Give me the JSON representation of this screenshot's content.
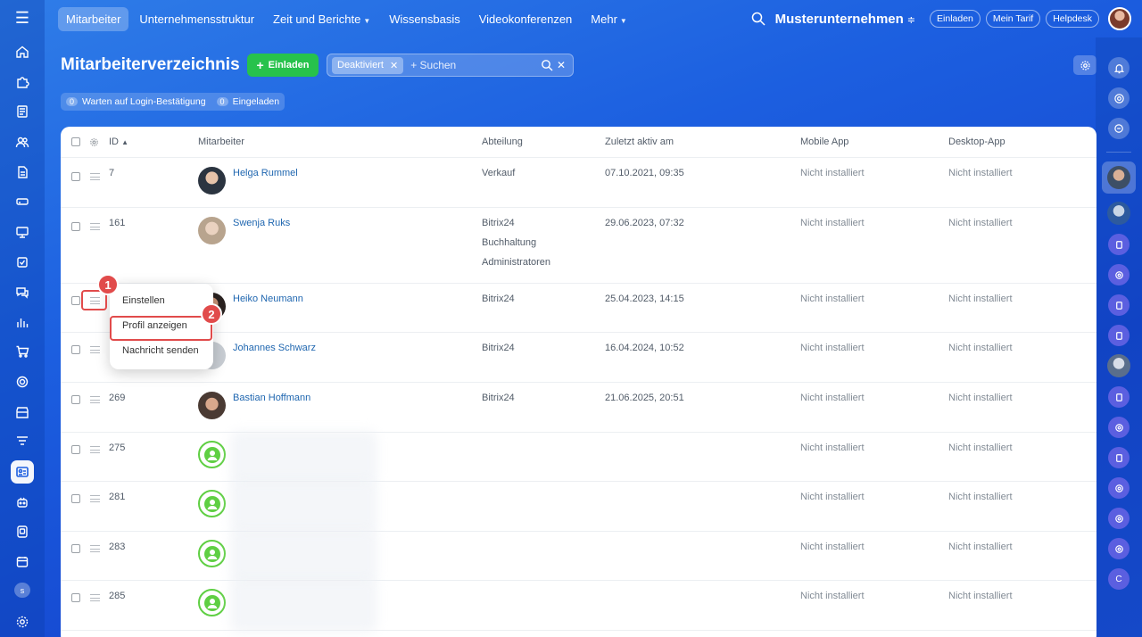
{
  "nav": {
    "tabs": [
      {
        "label": "Mitarbeiter"
      },
      {
        "label": "Unternehmensstruktur"
      },
      {
        "label": "Zeit und Berichte"
      },
      {
        "label": "Wissensbasis"
      },
      {
        "label": "Videokonferenzen"
      },
      {
        "label": "Mehr"
      }
    ],
    "company": "Musterunternehmen",
    "buttons": {
      "invite": "Einladen",
      "tariff": "Mein Tarif",
      "helpdesk": "Helpdesk"
    }
  },
  "sidebar": {
    "avatar_letter": "s"
  },
  "right_bar": {
    "bottom_letter": "C"
  },
  "page": {
    "title": "Mitarbeiterverzeichnis",
    "invite_button": "Einladen",
    "filter_chip": "Deaktiviert",
    "search_placeholder": "+ Suchen",
    "counters": [
      {
        "count": "0",
        "label": "Warten auf Login-Bestätigung"
      },
      {
        "count": "0",
        "label": "Eingeladen"
      }
    ]
  },
  "table": {
    "headers": {
      "id": "ID",
      "employee": "Mitarbeiter",
      "department": "Abteilung",
      "last_active": "Zuletzt aktiv am",
      "mobile": "Mobile App",
      "desktop": "Desktop-App"
    },
    "rows": [
      {
        "id": "7",
        "name": "Helga Rummel",
        "dept": [
          "Verkauf"
        ],
        "last": "07.10.2021, 09:35",
        "mobile": "Nicht installiert",
        "desktop": "Nicht installiert"
      },
      {
        "id": "161",
        "name": "Swenja Ruks",
        "dept": [
          "Bitrix24",
          "Buchhaltung",
          "Administratoren"
        ],
        "last": "29.06.2023, 07:32",
        "mobile": "Nicht installiert",
        "desktop": "Nicht installiert"
      },
      {
        "id": "",
        "name": "Heiko Neumann",
        "dept": [
          "Bitrix24"
        ],
        "last": "25.04.2023, 14:15",
        "mobile": "Nicht installiert",
        "desktop": "Nicht installiert"
      },
      {
        "id": "",
        "name": "Johannes Schwarz",
        "dept": [
          "Bitrix24"
        ],
        "last": "16.04.2024, 10:52",
        "mobile": "Nicht installiert",
        "desktop": "Nicht installiert"
      },
      {
        "id": "269",
        "name": "Bastian Hoffmann",
        "dept": [
          "Bitrix24"
        ],
        "last": "21.06.2025, 20:51",
        "mobile": "Nicht installiert",
        "desktop": "Nicht installiert"
      },
      {
        "id": "275",
        "name": "",
        "dept": [],
        "last": "",
        "mobile": "Nicht installiert",
        "desktop": "Nicht installiert"
      },
      {
        "id": "281",
        "name": "",
        "dept": [],
        "last": "",
        "mobile": "Nicht installiert",
        "desktop": "Nicht installiert"
      },
      {
        "id": "283",
        "name": "",
        "dept": [],
        "last": "",
        "mobile": "Nicht installiert",
        "desktop": "Nicht installiert"
      },
      {
        "id": "285",
        "name": "",
        "dept": [],
        "last": "",
        "mobile": "Nicht installiert",
        "desktop": "Nicht installiert"
      }
    ]
  },
  "context_menu": {
    "items": [
      {
        "label": "Einstellen"
      },
      {
        "label": "Profil anzeigen"
      },
      {
        "label": "Nachricht senden"
      }
    ]
  },
  "annotations": {
    "step1": "1",
    "step2": "2",
    "color": "#e14b4b"
  }
}
